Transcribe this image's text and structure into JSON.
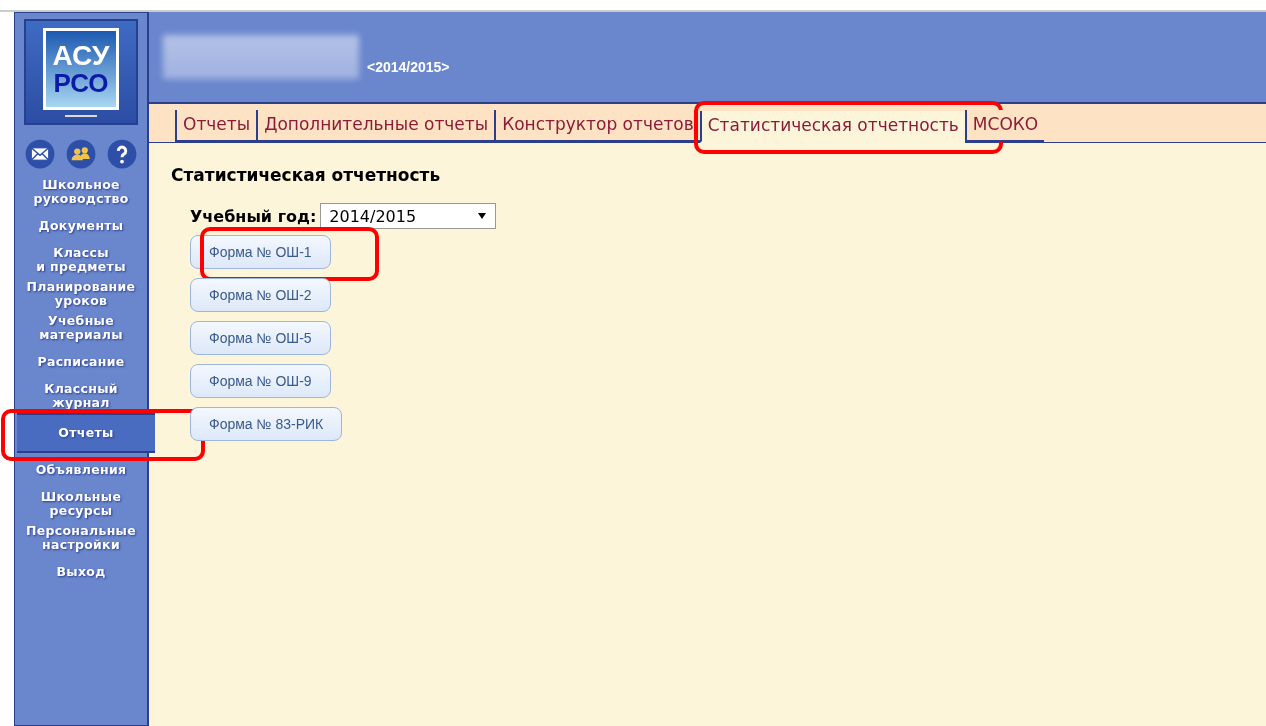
{
  "header": {
    "logo": {
      "line1": "АСУ",
      "line2": "РСО"
    },
    "year": "<2014/2015>"
  },
  "sidebar": {
    "items": [
      {
        "label": "Школьное\nруководство",
        "selected": false,
        "highlighted": false
      },
      {
        "label": "Документы",
        "selected": false,
        "highlighted": false
      },
      {
        "label": "Классы\nи предметы",
        "selected": false,
        "highlighted": false
      },
      {
        "label": "Планирование\nуроков",
        "selected": false,
        "highlighted": false
      },
      {
        "label": "Учебные\nматериалы",
        "selected": false,
        "highlighted": false
      },
      {
        "label": "Расписание",
        "selected": false,
        "highlighted": false
      },
      {
        "label": "Классный\nжурнал",
        "selected": false,
        "highlighted": false
      },
      {
        "label": "Отчеты",
        "selected": true,
        "highlighted": true
      },
      {
        "label": "Объявления",
        "selected": false,
        "highlighted": false
      },
      {
        "label": "Школьные\nресурсы",
        "selected": false,
        "highlighted": false
      },
      {
        "label": "Персональные\nнастройки",
        "selected": false,
        "highlighted": false
      },
      {
        "label": "Выход",
        "selected": false,
        "highlighted": false
      }
    ]
  },
  "tabs": [
    {
      "label": "Отчеты",
      "selected": false,
      "highlighted": false
    },
    {
      "label": "Дополнительные отчеты",
      "selected": false,
      "highlighted": false
    },
    {
      "label": "Конструктор отчетов",
      "selected": false,
      "highlighted": false
    },
    {
      "label": "Статистическая отчетность",
      "selected": true,
      "highlighted": true
    },
    {
      "label": "МСОКО",
      "selected": false,
      "highlighted": false
    }
  ],
  "page": {
    "title": "Статистическая отчетность",
    "year_label": "Учебный год:",
    "year_value": "2014/2015",
    "forms": [
      {
        "label": "Форма № ОШ-1",
        "highlighted": true
      },
      {
        "label": "Форма № ОШ-2",
        "highlighted": false
      },
      {
        "label": "Форма № ОШ-5",
        "highlighted": false
      },
      {
        "label": "Форма № ОШ-9",
        "highlighted": false
      },
      {
        "label": "Форма № 83-РИК",
        "highlighted": false
      }
    ]
  }
}
